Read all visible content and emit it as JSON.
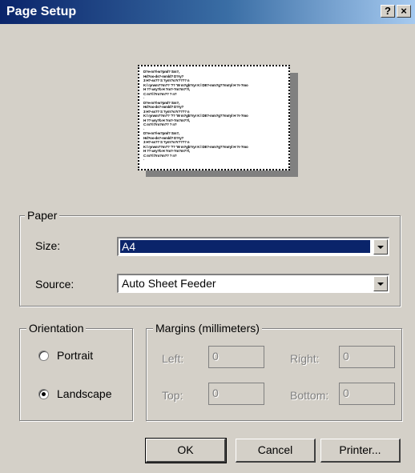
{
  "window": {
    "title": "Page Setup",
    "help_button": "?",
    "close_button": "×"
  },
  "preview": {
    "lines": [
      "D?e-m?l-w?pml? Sm?,",
      "Hd?oo-ds?-mmld? D?ry?",
      "3 H?-ss?? S ?yrrr?o?r???? n",
      " K l ryrwm??m?? '?? 'W m?gb?ryr K l DE?-mm?g??mrryl H ?r-?mo",
      "H ?? wry?b H ?m?-?m?m??l,",
      "C m?l l?ro?m?? ? n?",
      "·",
      "D?e-m?l-w?pml? Sm?,",
      "Hd?oo-ds?-mmld? D?ry?",
      "3 H?-ss?? S ?yrrr?o?r???? n",
      " K l ryrwm??m?? '?? 'W m?gb?ryr K l DE?-mm?g??mrryl H ?r-?mo",
      "H ?? wry?b H ?m?-?m?m??l,",
      "C m?l l?ro?m?? ? n?",
      "·",
      "D?e-m?l-w?pml? Sm?,",
      "Hd?oo-ds?-mmld? D?ry?",
      "3 H?-ss?? S ?yrrr?o?r???? n",
      " K l ryrwm??m?? '?? 'W m?gb?ryr K l DE?-mm?g??mrryl H ?r-?mo",
      "H ?? wry?b H ?m?-?m?m??l,",
      "C m?l l?ro?m?? ? n?",
      "·"
    ]
  },
  "paper": {
    "legend": "Paper",
    "size_label": "Size:",
    "size_value": "A4",
    "source_label": "Source:",
    "source_value": "Auto Sheet Feeder"
  },
  "orientation": {
    "legend": "Orientation",
    "portrait_label": "Portrait",
    "landscape_label": "Landscape",
    "selected": "landscape"
  },
  "margins": {
    "legend": "Margins (millimeters)",
    "left_label": "Left:",
    "left_value": "0",
    "right_label": "Right:",
    "right_value": "0",
    "top_label": "Top:",
    "top_value": "0",
    "bottom_label": "Bottom:",
    "bottom_value": "0"
  },
  "buttons": {
    "ok": "OK",
    "cancel": "Cancel",
    "printer": "Printer..."
  },
  "colors": {
    "title_bar": "#0a246a",
    "selection": "#0a246a",
    "dialog_bg": "#d4d0c8"
  }
}
